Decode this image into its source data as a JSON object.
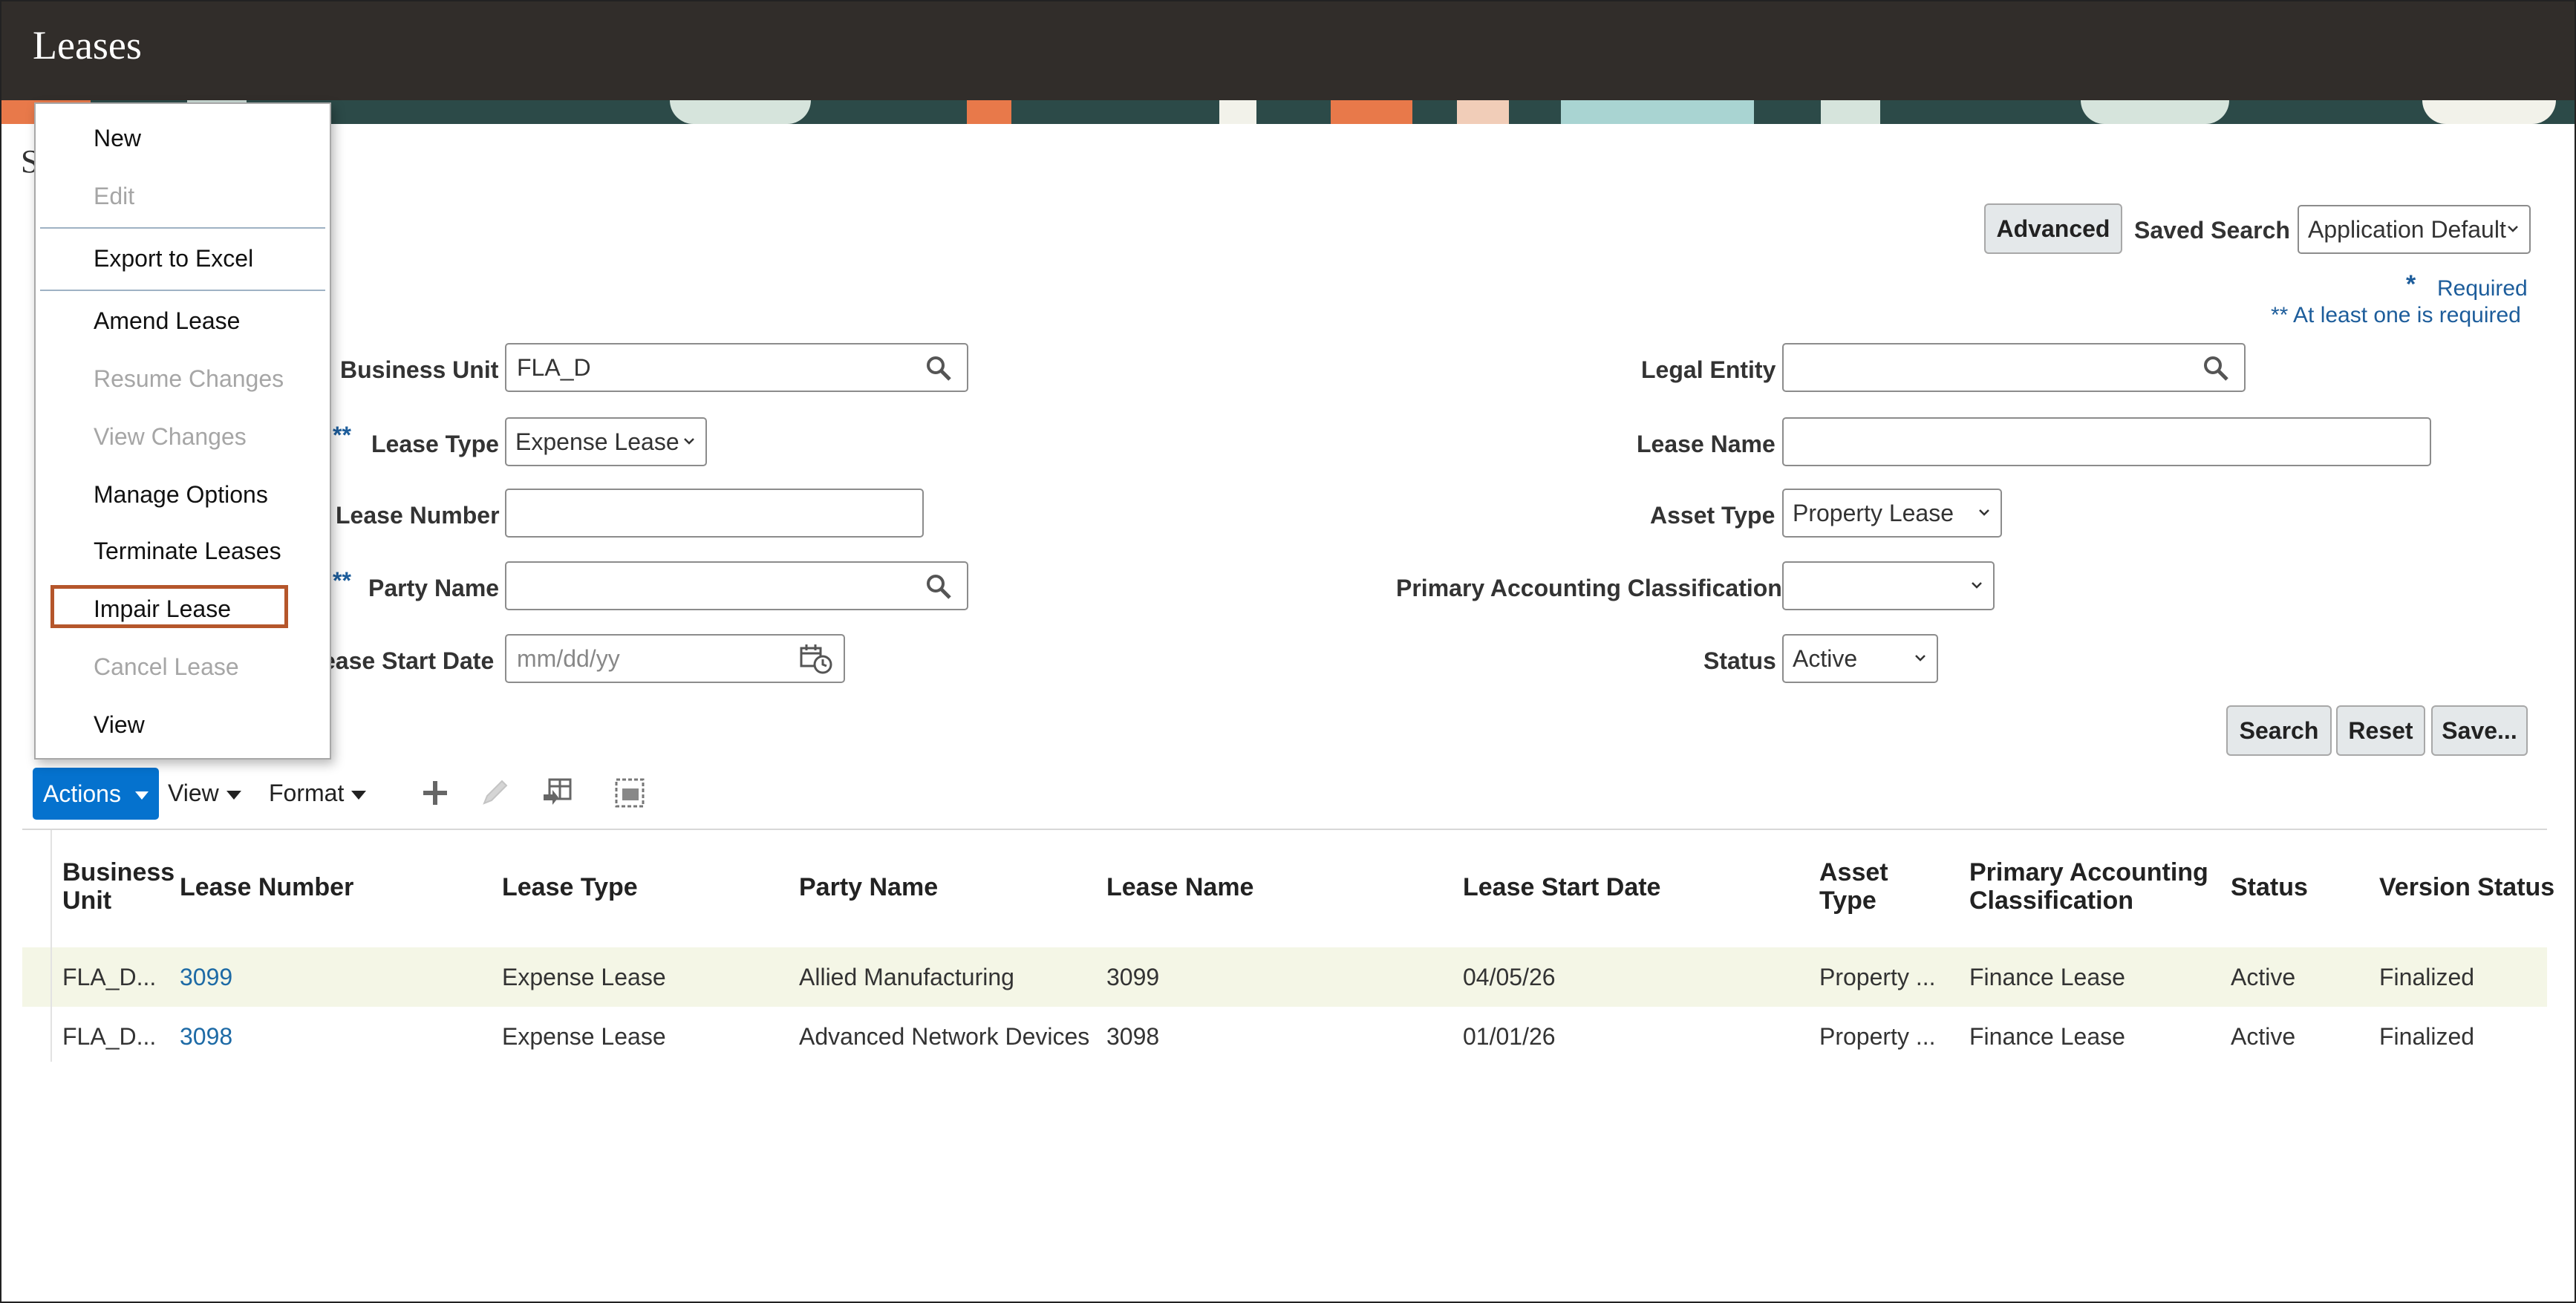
{
  "app": {
    "title": "Leases"
  },
  "search": {
    "advanced_label": "Advanced",
    "saved_search_label": "Saved Search",
    "saved_search_value": "Application Default",
    "required_note": "Required",
    "required_mark": "*",
    "at_least_one_note": "** At least one is required",
    "at_least_one_mark": "**",
    "section_initial": "S",
    "fields": {
      "business_unit": {
        "label": "Business Unit",
        "value": "FLA_D"
      },
      "lease_type": {
        "label": "Lease Type",
        "value": "Expense Lease"
      },
      "lease_number": {
        "label": "Lease Number",
        "value": ""
      },
      "party_name": {
        "label": "Party Name",
        "value": ""
      },
      "lease_start_date": {
        "label": "ease Start Date",
        "placeholder": "mm/dd/yy"
      },
      "legal_entity": {
        "label": "Legal Entity",
        "value": ""
      },
      "lease_name": {
        "label": "Lease Name",
        "value": ""
      },
      "asset_type": {
        "label": "Asset Type",
        "value": "Property Lease"
      },
      "primary_accounting_classification": {
        "label": "Primary Accounting Classification",
        "value": ""
      },
      "status": {
        "label": "Status",
        "value": "Active"
      }
    },
    "buttons": {
      "search": "Search",
      "reset": "Reset",
      "save": "Save..."
    }
  },
  "toolbar": {
    "actions": "Actions",
    "view": "View",
    "format": "Format",
    "icons": [
      "add-icon",
      "edit-icon",
      "freeze-icon",
      "detach-icon"
    ]
  },
  "actions_menu": {
    "items": [
      {
        "label": "New",
        "enabled": true
      },
      {
        "label": "Edit",
        "enabled": false
      },
      {
        "label": "Export to Excel",
        "enabled": true
      },
      {
        "label": "Amend Lease",
        "enabled": true
      },
      {
        "label": "Resume Changes",
        "enabled": false
      },
      {
        "label": "View Changes",
        "enabled": false
      },
      {
        "label": "Manage Options",
        "enabled": true
      },
      {
        "label": "Terminate Leases",
        "enabled": true
      },
      {
        "label": "Impair Lease",
        "enabled": true,
        "highlighted": true
      },
      {
        "label": "Cancel Lease",
        "enabled": false
      },
      {
        "label": "View",
        "enabled": true
      }
    ]
  },
  "table": {
    "columns": {
      "business_unit_1": "Business",
      "business_unit_2": "Unit",
      "lease_number": "Lease Number",
      "lease_type": "Lease Type",
      "party_name": "Party Name",
      "lease_name": "Lease Name",
      "lease_start_date": "Lease Start Date",
      "asset_type_1": "Asset",
      "asset_type_2": "Type",
      "pac_1": "Primary Accounting",
      "pac_2": "Classification",
      "status": "Status",
      "version_status": "Version Status"
    },
    "rows": [
      {
        "business_unit": "FLA_D...",
        "lease_number": "3099",
        "lease_type": "Expense Lease",
        "party_name": "Allied Manufacturing",
        "lease_name": "3099",
        "lease_start_date": "04/05/26",
        "asset_type": "Property ...",
        "pac": "Finance Lease",
        "status": "Active",
        "version_status": "Finalized"
      },
      {
        "business_unit": "FLA_D...",
        "lease_number": "3098",
        "lease_type": "Expense Lease",
        "party_name": "Advanced Network Devices",
        "lease_name": "3098",
        "lease_start_date": "01/01/26",
        "asset_type": "Property ...",
        "pac": "Finance Lease",
        "status": "Active",
        "version_status": "Finalized"
      }
    ]
  },
  "colors": {
    "header_bg": "#312d2a",
    "accent": "#0572ce",
    "link": "#1d6aa5",
    "highlight_box": "#b5562b"
  }
}
